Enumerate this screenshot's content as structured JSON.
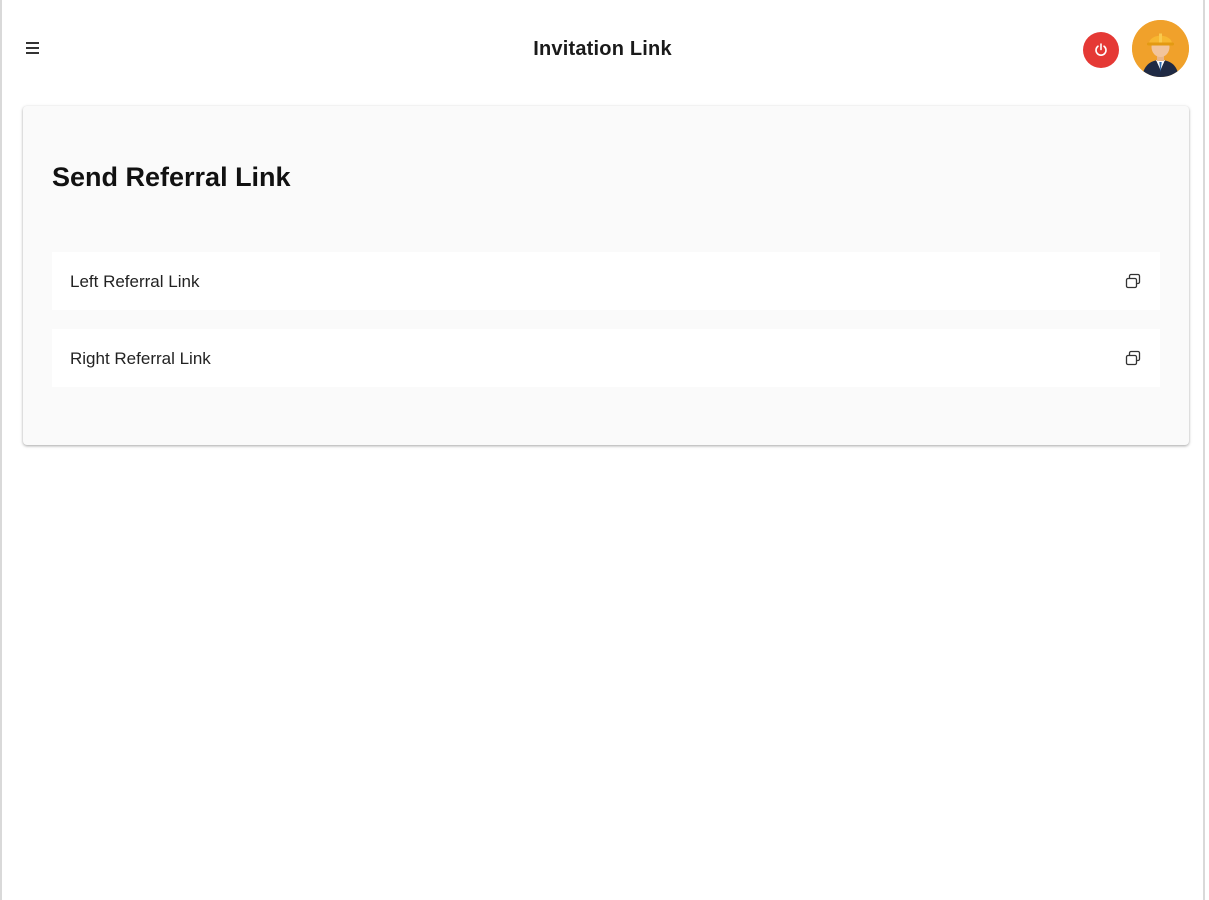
{
  "header": {
    "title": "Invitation Link",
    "menu_icon": "hamburger-menu-icon",
    "logout_icon": "power-icon",
    "avatar_icon": "user-avatar-icon",
    "logout_color": "#e53935",
    "avatar_color": "#f0a12b"
  },
  "card": {
    "title": "Send Referral Link",
    "links": [
      {
        "label": "Left Referral Link",
        "icon": "copy-icon"
      },
      {
        "label": "Right Referral Link",
        "icon": "copy-icon"
      }
    ]
  }
}
